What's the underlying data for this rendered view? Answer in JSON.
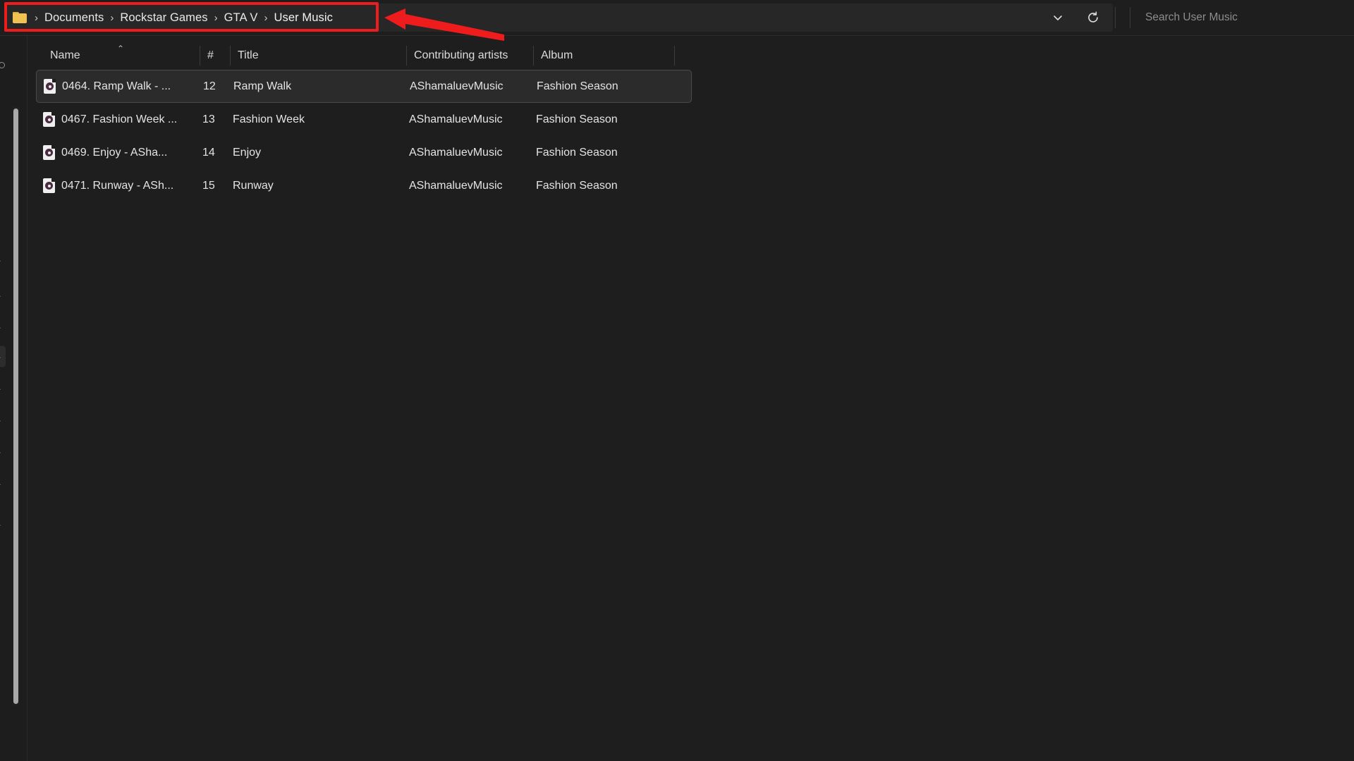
{
  "window": {
    "background_color": "#1e1e1e",
    "accent_annotation_color": "#ee1c1c"
  },
  "addressbar": {
    "folder_icon": "folder-icon",
    "separator": "›",
    "crumbs": [
      {
        "label": "Documents"
      },
      {
        "label": "Rockstar Games"
      },
      {
        "label": "GTA V"
      },
      {
        "label": "User Music"
      }
    ],
    "chevron_icon": "chevron-down-icon",
    "refresh_icon": "refresh-icon"
  },
  "search": {
    "placeholder": "Search User Music",
    "value": ""
  },
  "file_list": {
    "columns": [
      {
        "key": "name",
        "label": "Name",
        "sorted": "ascending",
        "sort_caret": "⌃"
      },
      {
        "key": "num",
        "label": "#"
      },
      {
        "key": "title",
        "label": "Title"
      },
      {
        "key": "artists",
        "label": "Contributing artists"
      },
      {
        "key": "album",
        "label": "Album"
      }
    ],
    "rows": [
      {
        "icon": "audio-file-icon",
        "name": "0464. Ramp Walk - ...",
        "num": "12",
        "title": "Ramp Walk",
        "artists": "AShamaluevMusic",
        "album": "Fashion Season",
        "selected": true
      },
      {
        "icon": "audio-file-icon",
        "name": "0467. Fashion Week ...",
        "num": "13",
        "title": "Fashion Week",
        "artists": "AShamaluevMusic",
        "album": "Fashion Season",
        "selected": false
      },
      {
        "icon": "audio-file-icon",
        "name": "0469. Enjoy - ASha...",
        "num": "14",
        "title": "Enjoy",
        "artists": "AShamaluevMusic",
        "album": "Fashion Season",
        "selected": false
      },
      {
        "icon": "audio-file-icon",
        "name": "0471. Runway - ASh...",
        "num": "15",
        "title": "Runway",
        "artists": "AShamaluevMusic",
        "album": "Fashion Season",
        "selected": false
      }
    ]
  },
  "annotations": {
    "highlight_box_target": "address-bar-breadcrumb",
    "arrow_direction": "left",
    "color": "#ee1c1c"
  }
}
